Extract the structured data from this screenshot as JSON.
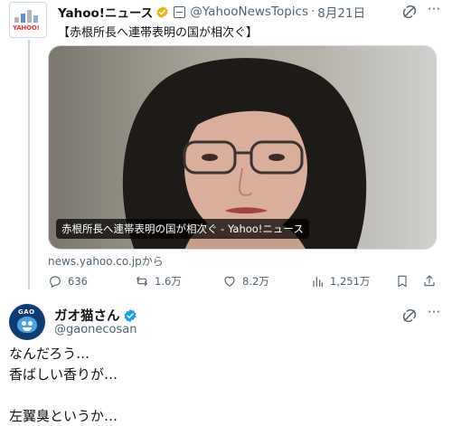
{
  "tweet1": {
    "avatar_logo": "YAHOO!",
    "name": "Yahoo!ニュース",
    "handle": "@YahooNewsTopics",
    "separator": "·",
    "date": "8月21日",
    "text": "【赤根所長へ連帯表明の国が相次ぐ】",
    "card": {
      "caption": "赤根所長へ連帯表明の国が相次ぐ - Yahoo!ニュース",
      "source": "news.yahoo.co.jpから"
    },
    "stats": {
      "replies": "636",
      "reposts": "1.6万",
      "likes": "8.2万",
      "views": "1,251万"
    }
  },
  "tweet2": {
    "avatar_text": "GAO",
    "name": "ガオ猫さん",
    "handle": "@gaonecosan",
    "lines": [
      "なんだろう…",
      "香ばしい香りが…",
      "",
      "左翼臭というか…"
    ]
  },
  "colors": {
    "gold_badge": "#e2b719",
    "blue_badge": "#1d9bf0",
    "muted_text": "#536471"
  }
}
